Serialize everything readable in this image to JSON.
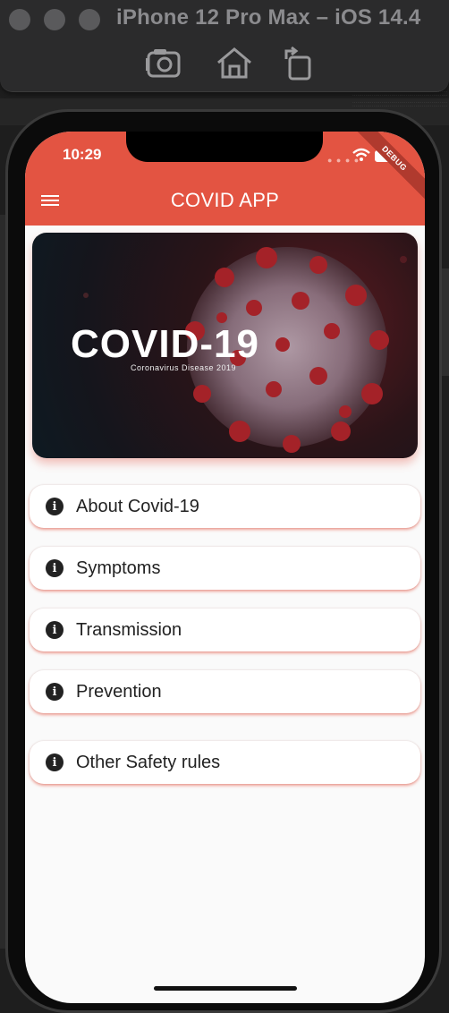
{
  "simulator": {
    "title": "iPhone 12 Pro Max – iOS 14.4",
    "toolbar": [
      "screenshot-icon",
      "home-icon",
      "rotate-icon"
    ]
  },
  "status_bar": {
    "time": "10:29",
    "debug_banner": "DEBUG"
  },
  "app_bar": {
    "title": "COVID APP",
    "menu_icon": "hamburger-menu-icon"
  },
  "hero": {
    "title": "COVID-19",
    "subtitle": "Coronavirus Disease 2019"
  },
  "menu_items": [
    {
      "label": "About Covid-19",
      "icon": "info-icon"
    },
    {
      "label": "Symptoms",
      "icon": "info-icon"
    },
    {
      "label": "Transmission",
      "icon": "info-icon"
    },
    {
      "label": "Prevention",
      "icon": "info-icon"
    },
    {
      "label": "Other Safety rules",
      "icon": "info-icon"
    }
  ],
  "colors": {
    "accent": "#e35442",
    "background": "#fafafa",
    "card": "#ffffff"
  }
}
